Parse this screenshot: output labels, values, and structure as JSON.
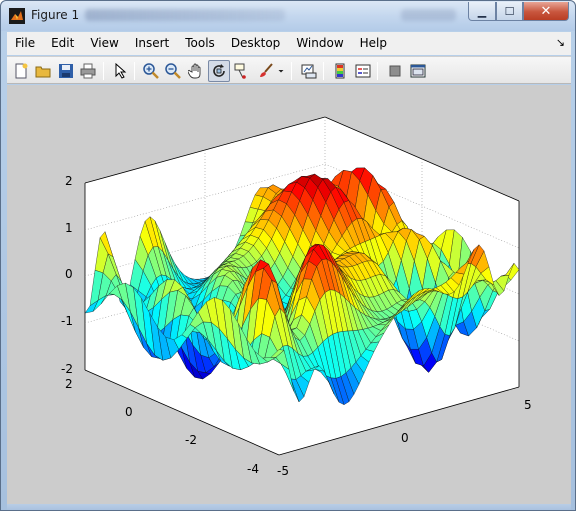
{
  "window": {
    "title": "Figure 1",
    "minimize_glyph": "▁",
    "maximize_glyph": "☐",
    "close_glyph": "✕"
  },
  "menubar": {
    "items": [
      {
        "label": "File"
      },
      {
        "label": "Edit"
      },
      {
        "label": "View"
      },
      {
        "label": "Insert"
      },
      {
        "label": "Tools"
      },
      {
        "label": "Desktop"
      },
      {
        "label": "Window"
      },
      {
        "label": "Help"
      }
    ],
    "dock_arrow": "↘"
  },
  "toolbar": {
    "icons": [
      "new-figure-icon",
      "open-file-icon",
      "save-icon",
      "print-icon",
      "edit-plot-arrow-icon",
      "zoom-in-icon",
      "zoom-out-icon",
      "pan-hand-icon",
      "rotate-3d-icon",
      "data-cursor-icon",
      "brush-icon",
      "link-plot-icon",
      "colorbar-icon",
      "legend-icon",
      "hide-plot-tools-icon",
      "show-plot-tools-icon"
    ],
    "rotate_3d_active": true
  },
  "axes": {
    "z_ticks": [
      "2",
      "1",
      "0",
      "-1",
      "-2"
    ],
    "left_ticks": [
      "2",
      "0",
      "-2",
      "-4"
    ],
    "right_ticks": [
      "-5",
      "0",
      "5"
    ],
    "colormap": "jet",
    "grid": true,
    "box": true
  },
  "colors": {
    "figure_background": "#cccccc",
    "axes_background": "#ffffff",
    "titlebar": "#c4d7ee",
    "close_button": "#c8563e"
  }
}
